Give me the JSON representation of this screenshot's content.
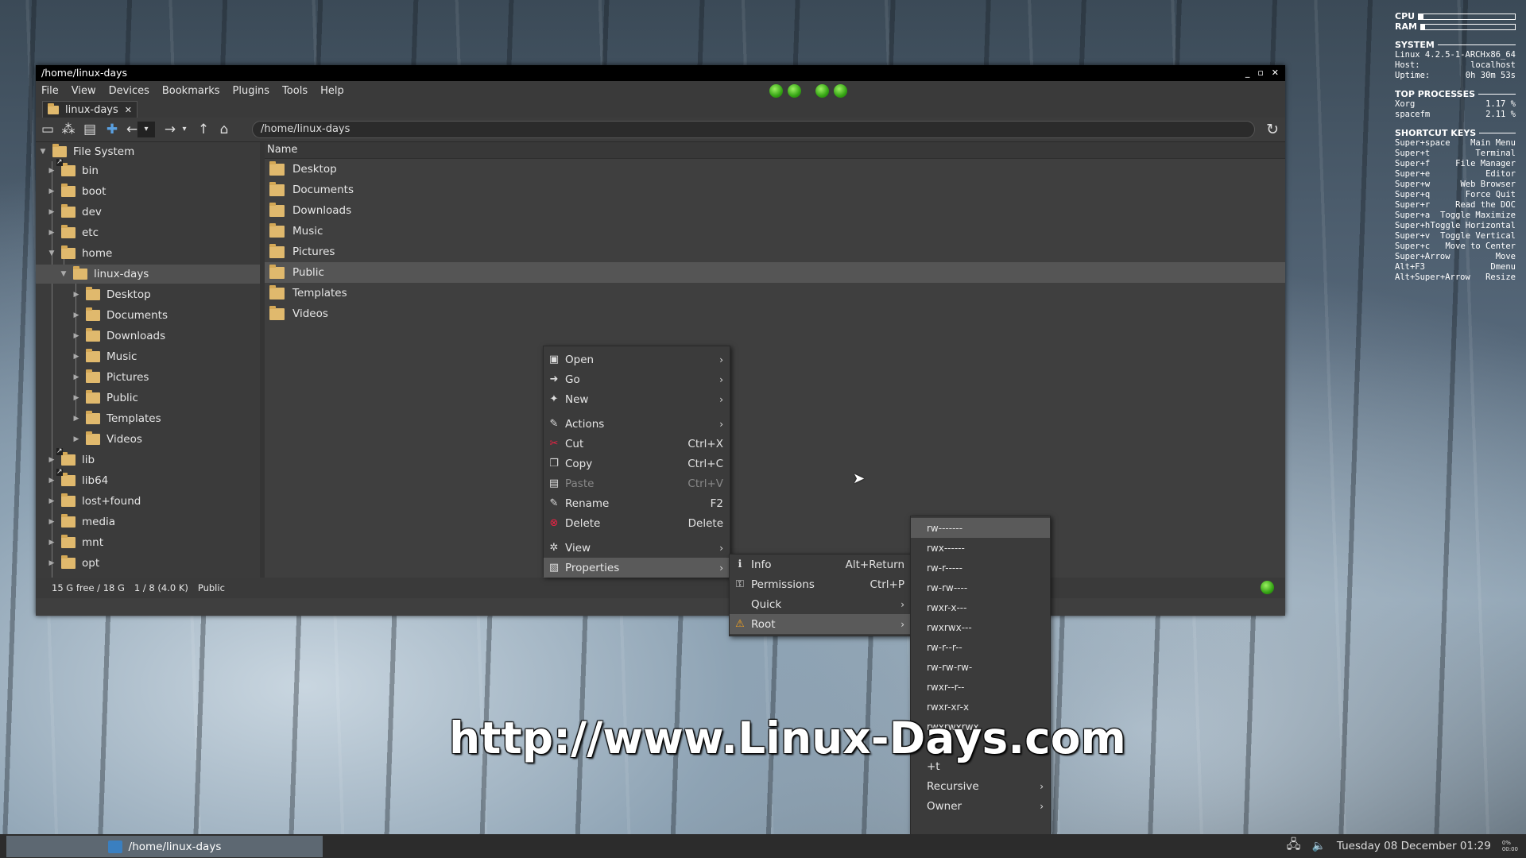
{
  "window": {
    "title": "/home/linux-days",
    "controls": [
      "_",
      "▫",
      "✕"
    ]
  },
  "menubar": [
    "File",
    "View",
    "Devices",
    "Bookmarks",
    "Plugins",
    "Tools",
    "Help"
  ],
  "tab": {
    "label": "linux-days",
    "close": "✕"
  },
  "toolbar": {
    "path": "/home/linux-days"
  },
  "tree": {
    "root": "File System",
    "items": [
      "bin",
      "boot",
      "dev",
      "etc",
      "home",
      "linux-days",
      "Desktop",
      "Documents",
      "Downloads",
      "Music",
      "Pictures",
      "Public",
      "Templates",
      "Videos",
      "lib",
      "lib64",
      "lost+found",
      "media",
      "mnt",
      "opt"
    ]
  },
  "filelist": {
    "column": "Name",
    "items": [
      "Desktop",
      "Documents",
      "Downloads",
      "Music",
      "Pictures",
      "Public",
      "Templates",
      "Videos"
    ]
  },
  "status": {
    "free": "15 G free / 18 G",
    "count": "1 / 8 (4.0 K)",
    "selected": "Public"
  },
  "context_menu": {
    "items": [
      {
        "label": "Open",
        "accel": "",
        "sub": true
      },
      {
        "label": "Go",
        "accel": "",
        "sub": true
      },
      {
        "label": "New",
        "accel": "",
        "sub": true
      },
      {
        "label": "Actions",
        "accel": "",
        "sub": true
      },
      {
        "label": "Cut",
        "accel": "Ctrl+X"
      },
      {
        "label": "Copy",
        "accel": "Ctrl+C"
      },
      {
        "label": "Paste",
        "accel": "Ctrl+V"
      },
      {
        "label": "Rename",
        "accel": "F2"
      },
      {
        "label": "Delete",
        "accel": "Delete"
      },
      {
        "label": "View",
        "accel": "",
        "sub": true
      },
      {
        "label": "Properties",
        "accel": "",
        "sub": true
      }
    ]
  },
  "properties_menu": {
    "items": [
      {
        "label": "Info",
        "accel": "Alt+Return"
      },
      {
        "label": "Permissions",
        "accel": "Ctrl+P"
      },
      {
        "label": "Quick",
        "accel": "",
        "sub": true
      },
      {
        "label": "Root",
        "accel": "",
        "sub": true
      }
    ]
  },
  "root_menu": {
    "items": [
      "rw-------",
      "rwx------",
      "rw-r-----",
      "rw-rw----",
      "rwxr-x---",
      "rwxrwx---",
      "rw-r--r--",
      "rw-rw-rw-",
      "rwxr--r--",
      "rwxr-xr-x",
      "rwxrwxrwx",
      "-t",
      "+t",
      "Recursive",
      "Owner"
    ]
  },
  "watermark": "http://www.Linux-Days.com",
  "conky": {
    "cpu_label": "CPU",
    "ram_label": "RAM",
    "cpu_level": 0.05,
    "ram_level": 0.04,
    "system_title": "SYSTEM",
    "system_rows": [
      {
        "k": "Linux 4.2.5-1-ARCH",
        "v": "x86_64"
      },
      {
        "k": "Host:",
        "v": "localhost"
      },
      {
        "k": "Uptime:",
        "v": "0h 30m 53s"
      }
    ],
    "processes_title": "TOP PROCESSES",
    "processes": [
      {
        "k": "Xorg",
        "v": "1.17 %"
      },
      {
        "k": "spacefm",
        "v": "2.11 %"
      }
    ],
    "keys_title": "SHORTCUT KEYS",
    "keys": [
      {
        "k": "Super+space",
        "v": "Main Menu"
      },
      {
        "k": "Super+t",
        "v": "Terminal"
      },
      {
        "k": "Super+f",
        "v": "File Manager"
      },
      {
        "k": "Super+e",
        "v": "Editor"
      },
      {
        "k": "Super+w",
        "v": "Web Browser"
      },
      {
        "k": "Super+q",
        "v": "Force Quit"
      },
      {
        "k": "Super+r",
        "v": "Read the DOC"
      },
      {
        "k": "Super+a",
        "v": "Toggle Maximize"
      },
      {
        "k": "Super+h",
        "v": "Toggle Horizontal"
      },
      {
        "k": "Super+v",
        "v": "Toggle Vertical"
      },
      {
        "k": "Super+c",
        "v": "Move to Center"
      },
      {
        "k": "Super+Arrow",
        "v": "Move"
      },
      {
        "k": "Alt+F3",
        "v": "Dmenu"
      },
      {
        "k": "Alt+Super+Arrow",
        "v": "Resize"
      }
    ]
  },
  "taskbar": {
    "task": "/home/linux-days",
    "clock": "Tuesday 08 December 01:29",
    "cpu_mini": "0%\n00:00"
  }
}
